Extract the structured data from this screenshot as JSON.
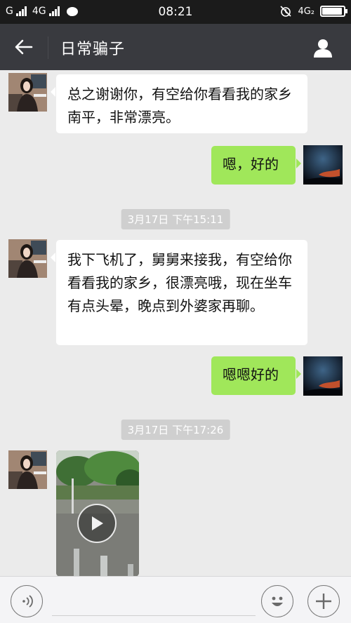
{
  "status_bar": {
    "carrier1": "G",
    "carrier2": "4G",
    "time": "08:21",
    "net_right": "4G₂",
    "battery_level": 0.92,
    "icons": [
      "signal-icon",
      "signal-icon",
      "chat-bubble-icon",
      "mute-alarm-icon",
      "battery-icon"
    ]
  },
  "header": {
    "title": "日常骗子"
  },
  "messages": [
    {
      "side": "left",
      "text": "总之谢谢你，有空给你看看我的家乡南平，非常漂亮。"
    },
    {
      "side": "right",
      "text": "嗯，好的"
    },
    {
      "type": "timestamp",
      "text": "3月17日 下午15:11"
    },
    {
      "side": "left",
      "text": "我下飞机了，舅舅来接我，有空给你看看我的家乡，很漂亮哦，现在坐车有点头晕，晚点到外婆家再聊。"
    },
    {
      "side": "right",
      "text": "嗯嗯好的"
    },
    {
      "type": "timestamp",
      "text": "3月17日 下午17:26"
    },
    {
      "side": "left",
      "type": "video"
    }
  ],
  "input_bar": {
    "value": "",
    "placeholder": ""
  },
  "colors": {
    "nav_bg": "#393a3f",
    "status_bg": "#1b1b1b",
    "chat_bg": "#ebebeb",
    "bubble_in": "#ffffff",
    "bubble_out": "#a0e75a",
    "timestamp_bg": "#cfcfcf"
  }
}
